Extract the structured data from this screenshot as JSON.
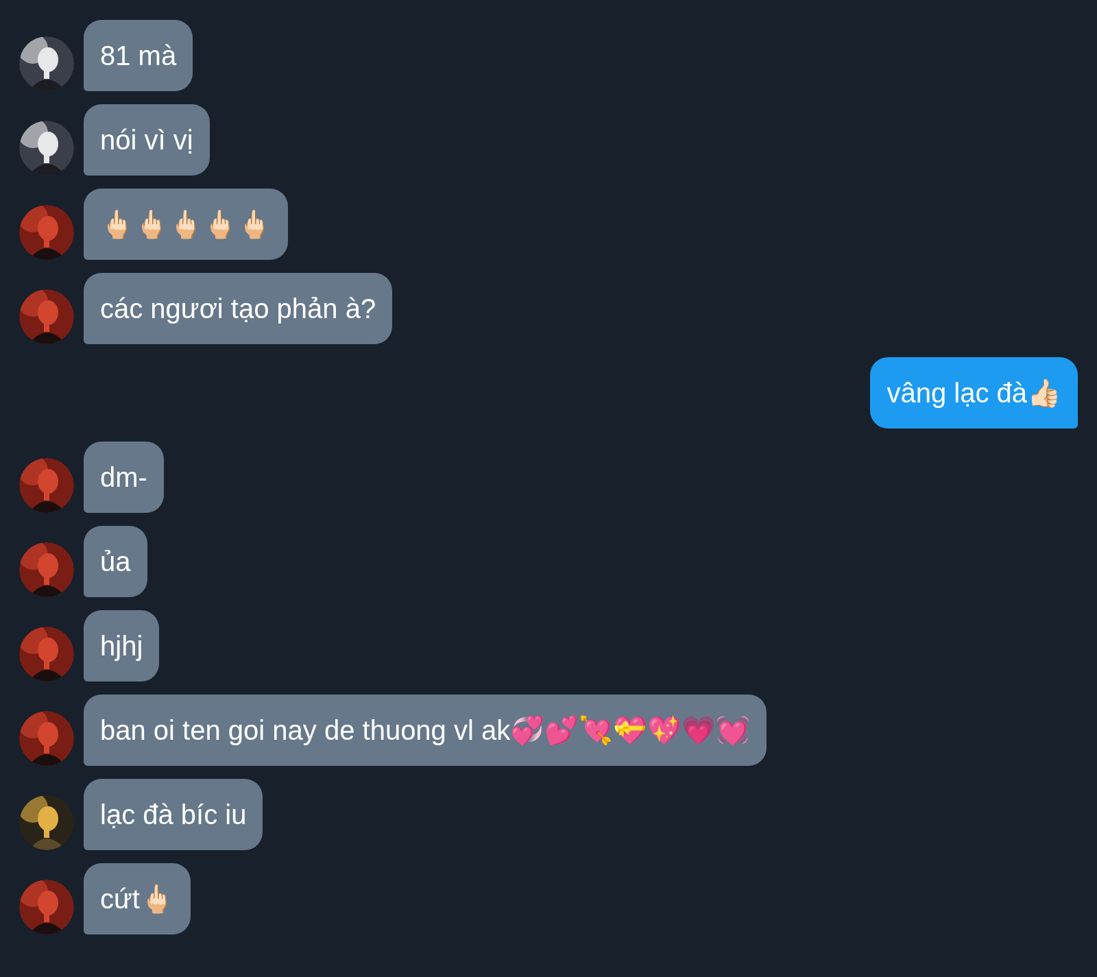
{
  "messages": [
    {
      "kind": "received",
      "text": "81 mà"
    },
    {
      "kind": "received",
      "text": "nói vì vị"
    },
    {
      "kind": "received",
      "text": "🖕🏻🖕🏻🖕🏻🖕🏻🖕🏻"
    },
    {
      "kind": "received",
      "text": "các ngươi tạo phản à?"
    },
    {
      "kind": "sent",
      "text": "vâng lạc đà👍🏻"
    },
    {
      "kind": "received",
      "text": "dm-"
    },
    {
      "kind": "received",
      "text": "ủa"
    },
    {
      "kind": "received",
      "text": "hjhj"
    },
    {
      "kind": "received",
      "text": "ban oi ten goi nay de thuong vl ak💞💕💘💝💖💗💓"
    },
    {
      "kind": "received",
      "text": "lạc đà bíc iu"
    },
    {
      "kind": "received",
      "text": "cứt🖕🏻"
    }
  ]
}
